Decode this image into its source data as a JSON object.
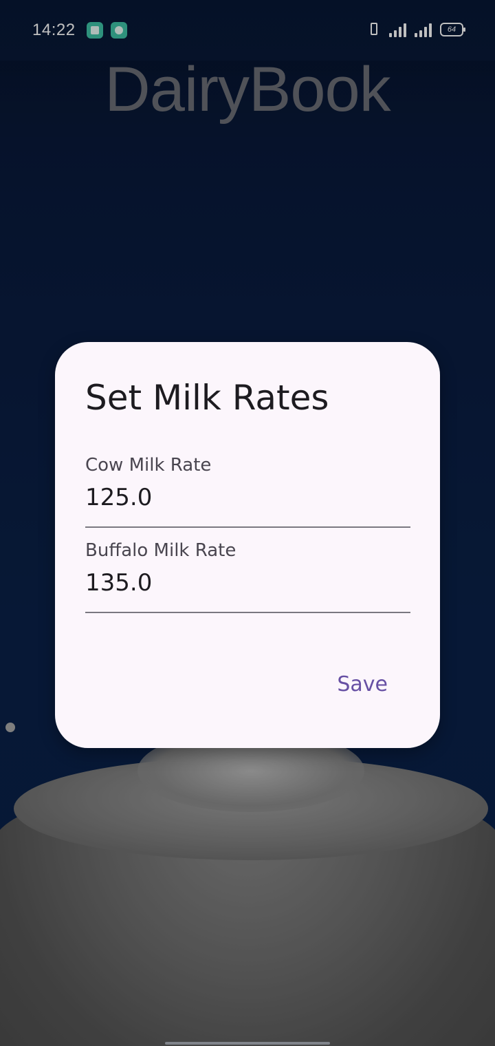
{
  "status_bar": {
    "time": "14:22",
    "battery_level": "64",
    "notification_icons": [
      "app-notification-icon",
      "chat-notification-icon"
    ],
    "system_icons": [
      "vibrate-icon",
      "signal-icon",
      "signal-icon",
      "battery-icon"
    ]
  },
  "app": {
    "title": "DairyBook"
  },
  "dialog": {
    "title": "Set Milk Rates",
    "fields": [
      {
        "label": "Cow Milk Rate",
        "value": "125.0"
      },
      {
        "label": "Buffalo Milk Rate",
        "value": "135.0"
      }
    ],
    "save_label": "Save"
  },
  "colors": {
    "background": "#0a1c40",
    "dialog_surface": "#fcf6fc",
    "accent": "#6750a4",
    "title_text": "#6b6e76"
  }
}
